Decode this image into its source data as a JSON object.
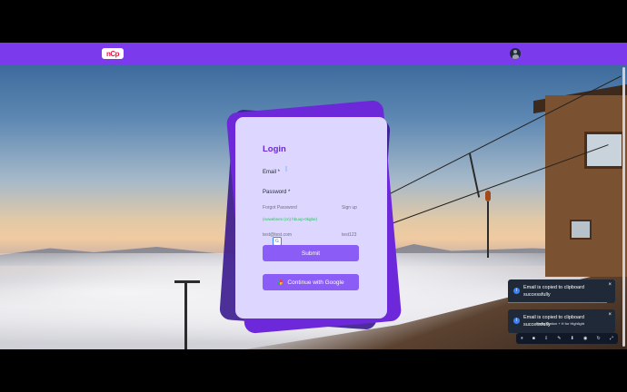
{
  "header": {
    "logo_text": "nCp"
  },
  "login": {
    "title": "Login",
    "email_label": "Email *",
    "password_label": "Password *",
    "forgot_label": "Forgot Password",
    "signup_label": "Sign up",
    "hash_text": "(nowebnes (cn) hbuup-0kgbe)",
    "email_hint": "test@test.com",
    "password_hint": "test123",
    "submit_label": "Submit",
    "google_label": "Continue with Google"
  },
  "toasts": [
    {
      "message": "Email is copied to clipboard successfully",
      "close": "×"
    },
    {
      "message": "Email is copied to clipboard successfully",
      "close": "×"
    }
  ],
  "recorder": {
    "hint": "Press Option + H for Highlight",
    "controls": [
      "⏸",
      "■",
      "⇩",
      "✎",
      "⬇",
      "◉",
      "↻",
      "⤢"
    ]
  },
  "colors": {
    "brand": "#7c3aed",
    "card": "#ddd6fe",
    "button": "#8b5cf6",
    "toast": "#1f2937"
  }
}
